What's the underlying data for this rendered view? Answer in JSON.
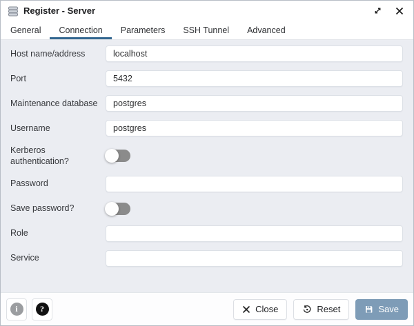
{
  "window": {
    "title": "Register - Server",
    "title_icon": "server-stack-icon",
    "controls": {
      "maximize": "maximize-icon",
      "close": "close-icon"
    }
  },
  "tabs": [
    {
      "label": "General",
      "active": false
    },
    {
      "label": "Connection",
      "active": true
    },
    {
      "label": "Parameters",
      "active": false
    },
    {
      "label": "SSH Tunnel",
      "active": false
    },
    {
      "label": "Advanced",
      "active": false
    }
  ],
  "form": {
    "fields": [
      {
        "label": "Host name/address",
        "type": "text",
        "value": "localhost",
        "placeholder": ""
      },
      {
        "label": "Port",
        "type": "text",
        "value": "5432",
        "placeholder": ""
      },
      {
        "label": "Maintenance database",
        "type": "text",
        "value": "postgres",
        "placeholder": ""
      },
      {
        "label": "Username",
        "type": "text",
        "value": "postgres",
        "placeholder": ""
      },
      {
        "label": "Kerberos authentication?",
        "type": "toggle",
        "value": false
      },
      {
        "label": "Password",
        "type": "password",
        "value": "",
        "placeholder": ""
      },
      {
        "label": "Save password?",
        "type": "toggle",
        "value": false
      },
      {
        "label": "Role",
        "type": "text",
        "value": "",
        "placeholder": ""
      },
      {
        "label": "Service",
        "type": "text",
        "value": "",
        "placeholder": ""
      }
    ]
  },
  "footer": {
    "info_icon": "info-icon",
    "help_icon": "help-icon",
    "close_label": "Close",
    "reset_label": "Reset",
    "save_label": "Save"
  },
  "colors": {
    "accent_tab_underline": "#326690",
    "save_button": "#7e9cb7",
    "content_background": "#ebedf2",
    "toggle_track_off": "#8b8b8b",
    "dialog_background": "#ffffff"
  }
}
